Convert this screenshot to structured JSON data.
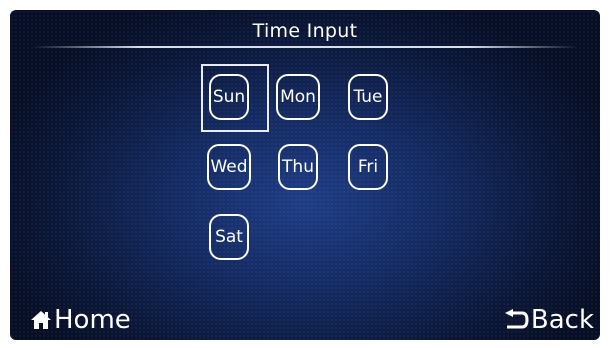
{
  "header": {
    "title": "Time Input"
  },
  "days": [
    {
      "label": "Sun",
      "selected": true
    },
    {
      "label": "Mon",
      "selected": false
    },
    {
      "label": "Tue",
      "selected": false
    },
    {
      "label": "Wed",
      "selected": false
    },
    {
      "label": "Thu",
      "selected": false
    },
    {
      "label": "Fri",
      "selected": false
    },
    {
      "label": "Sat",
      "selected": false
    }
  ],
  "footer": {
    "home_label": "Home",
    "home_icon": "home-icon",
    "back_label": "Back",
    "back_icon": "back-arrow-icon"
  },
  "colors": {
    "background": "#142b63",
    "foreground": "#ffffff"
  }
}
